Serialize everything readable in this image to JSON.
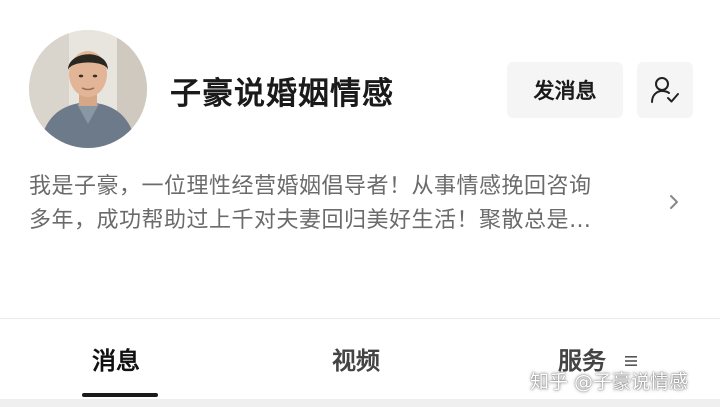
{
  "profile": {
    "name": "子豪说婚姻情感",
    "bio_lines": [
      "我是子豪，一位理性经营婚姻倡导者！从事情感挽回咨询",
      "多年，成功帮助过上千对夫妻回归美好生活！聚散总是…"
    ],
    "message_button": "发消息",
    "follow_icon": "user-check-icon",
    "more_icon": "chevron-right-icon"
  },
  "tabs": [
    {
      "label": "消息",
      "active": true
    },
    {
      "label": "视频",
      "active": false
    },
    {
      "label": "服务",
      "active": false
    }
  ],
  "watermark": "知乎 @子豪说情感",
  "colors": {
    "background": "#ffffff",
    "button_bg": "#f5f5f5",
    "bio_text": "#6b6b6b",
    "primary_text": "#1a1a1a"
  }
}
